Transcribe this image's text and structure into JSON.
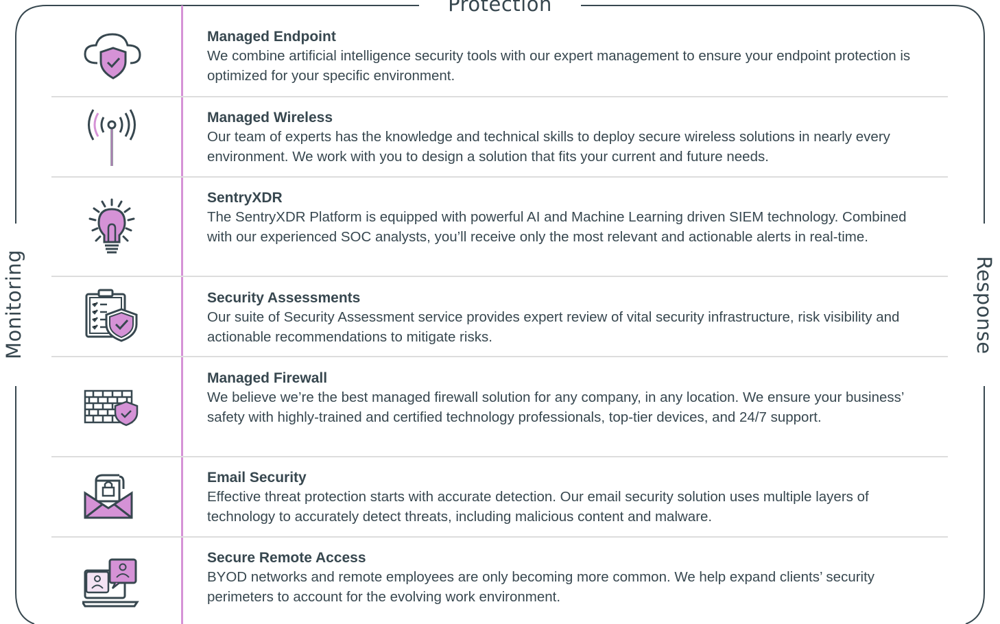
{
  "frame_labels": {
    "top": "Protection",
    "left": "Monitoring",
    "right": "Response"
  },
  "colors": {
    "accent": "#d592d6",
    "text": "#37474f",
    "separator": "#dddddd",
    "frame": "#37474f"
  },
  "services": [
    {
      "icon": "cloud-shield-icon",
      "title": "Managed Endpoint",
      "description": "We combine artificial intelligence security tools with our expert management to ensure your endpoint protection is optimized for your specific environment."
    },
    {
      "icon": "wireless-antenna-icon",
      "title": "Managed Wireless",
      "description": "Our team of experts has the knowledge and technical skills to deploy secure wireless solutions in nearly every environment. We work with you to design a solution that fits your current and future needs."
    },
    {
      "icon": "lightbulb-icon",
      "title": "SentryXDR",
      "description": "The SentryXDR Platform is equipped with powerful AI and Machine Learning driven SIEM technology. Combined with our experienced SOC analysts, you’ll receive only the most relevant and actionable alerts in real-time."
    },
    {
      "icon": "clipboard-shield-icon",
      "title": "Security Assessments",
      "description": "Our suite of Security Assessment service provides expert review of vital security infrastructure, risk visibility and actionable recommendations to mitigate risks."
    },
    {
      "icon": "firewall-shield-icon",
      "title": "Managed Firewall",
      "description": "We believe we’re the best managed firewall solution for any company, in any location. We ensure your business’ safety with highly-trained and certified technology professionals, top-tier devices, and 24/7 support."
    },
    {
      "icon": "envelope-lock-icon",
      "title": "Email Security",
      "description": "Effective threat protection starts with accurate detection. Our email security solution uses multiple layers of technology to accurately detect threats, including malicious content and malware."
    },
    {
      "icon": "remote-access-icon",
      "title": "Secure Remote Access",
      "description": "BYOD networks and remote employees are only becoming more common. We help expand clients’ security perimeters to account for the evolving work environment."
    }
  ]
}
